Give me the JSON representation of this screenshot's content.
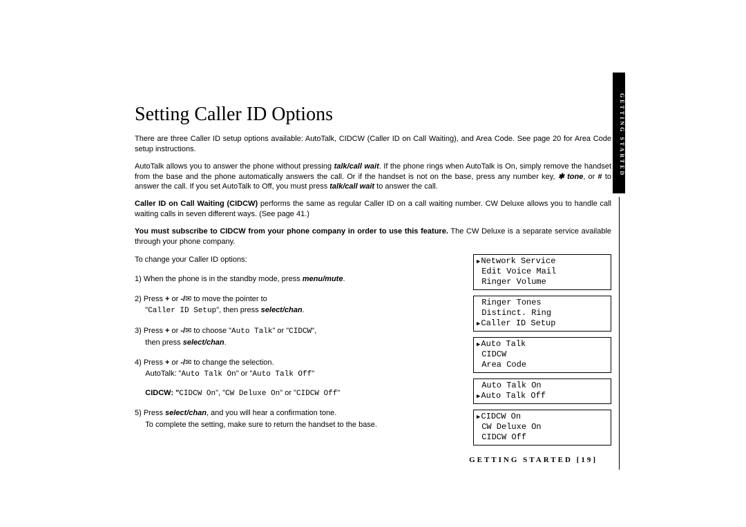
{
  "sideTab": "GETTING STARTED",
  "title": "Setting Caller ID Options",
  "intro": "There are three Caller ID setup options available: AutoTalk, CIDCW (Caller ID on Call Waiting), and Area Code. See page 20 for Area Code setup instructions.",
  "autotalk_pre": "AutoTalk allows you to answer the phone without pressing ",
  "talk_call_wait": "talk/call wait",
  "autotalk_mid": ". If the phone rings when AutoTalk is On, simply remove the handset from the base and the phone automatically answers the call. Or if the handset is not on the base, press any number key, ",
  "star_tone": "✱ tone",
  "autotalk_mid2": ", or ",
  "hash": "#",
  "autotalk_mid3": " to answer the call. If you set AutoTalk to Off, you must press ",
  "autotalk_end": " to answer the call.",
  "cidcw_label": "Caller ID on Call Waiting (CIDCW)",
  "cidcw_text": " performs the same as regular Caller ID on a call waiting number. CW Deluxe allows you to handle call waiting calls in seven different ways. (See page 41.)",
  "subscribe_bold": "You must subscribe to CIDCW from your phone company in order to use this feature.",
  "subscribe_rest": " The CW Deluxe is a separate service available through your phone company.",
  "steps_lead": "To change your Caller ID options:",
  "steps": {
    "s1_pre": "1)  When the phone is in the standby mode, press ",
    "s1_btn": "menu/mute",
    "s1_post": ".",
    "s2_pre": "2)  Press ",
    "plus": "+",
    "or": " or ",
    "minus_slash": "-/",
    "s2_mid": " to move the pointer to",
    "s2_quote": "Caller ID Setup",
    "s2_then": "\", then press ",
    "select_chan": "select/chan",
    "s3_pre": "3)  Press ",
    "s3_mid": " to choose \"",
    "auto_talk": "Auto Talk",
    "s3_or": "\" or \"",
    "cidcw_lit": "CIDCW",
    "s3_then": "\",",
    "s3_then2": "then press ",
    "s4_pre": "4)  Press ",
    "s4_mid": " to change the selection.",
    "s4_at_lbl": "AutoTalk: \"",
    "auto_talk_on": "Auto Talk On",
    "s4_or": "\" or \"",
    "auto_talk_off": "Auto Talk Off",
    "s4_end": "\"",
    "s4_cidcw_lbl": "CIDCW: \"",
    "cidcw_on": "CIDCW On",
    "s4_comma": "\", \"",
    "cwdeluxe_on": "CW Deluxe On",
    "cidcw_off": "CIDCW Off",
    "s5_pre": "5)  Press ",
    "s5_mid": ", and you will hear a confirmation tone.",
    "s5_note": "To complete the setting, make sure to return the handset to the base."
  },
  "lcd": {
    "box1": {
      "r1": "Network Service",
      "r2": "Edit Voice Mail",
      "r3": "Ringer Volume"
    },
    "box2": {
      "r1": "Ringer Tones",
      "r2": "Distinct. Ring",
      "r3": "Caller ID Setup"
    },
    "box3": {
      "r1": "Auto Talk",
      "r2": "CIDCW",
      "r3": "Area Code"
    },
    "box4": {
      "r1": "Auto Talk On",
      "r2": "Auto Talk Off"
    },
    "box5": {
      "r1": "CIDCW On",
      "r2": "CW Deluxe On",
      "r3": "CIDCW Off"
    }
  },
  "footer": "GETTING STARTED  [19]"
}
